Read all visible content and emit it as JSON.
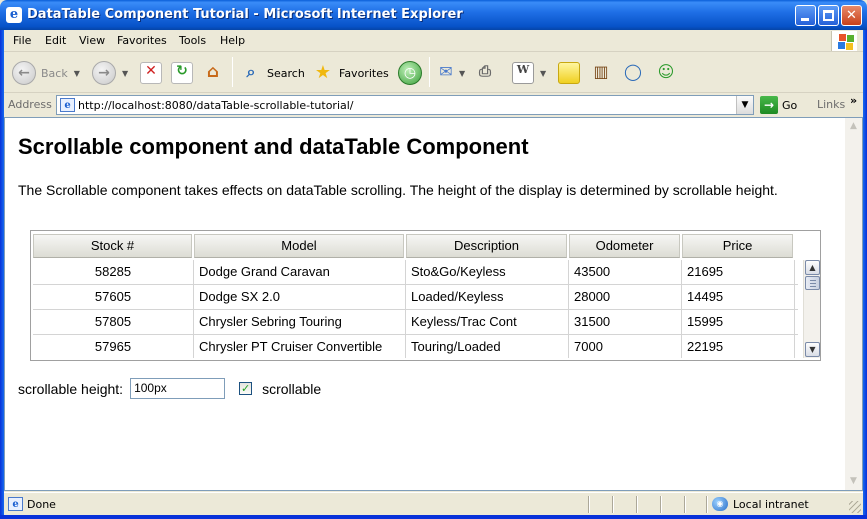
{
  "window": {
    "title": "DataTable Component Tutorial - Microsoft Internet Explorer"
  },
  "menu": [
    "File",
    "Edit",
    "View",
    "Favorites",
    "Tools",
    "Help"
  ],
  "toolbar": {
    "back_label": "Back",
    "search_label": "Search",
    "favorites_label": "Favorites"
  },
  "address": {
    "label": "Address",
    "url": "http://localhost:8080/dataTable-scrollable-tutorial/",
    "go_label": "Go",
    "links_label": "Links"
  },
  "page": {
    "heading": "Scrollable component and dataTable Component",
    "intro": "The Scrollable component takes effects on dataTable scrolling. The height of the display is determined by scrollable height."
  },
  "table": {
    "columns": [
      "Stock #",
      "Model",
      "Description",
      "Odometer",
      "Price"
    ],
    "rows": [
      [
        "58285",
        "Dodge Grand Caravan",
        "Sto&Go/Keyless",
        "43500",
        "21695"
      ],
      [
        "57605",
        "Dodge SX 2.0",
        "Loaded/Keyless",
        "28000",
        "14495"
      ],
      [
        "57805",
        "Chrysler Sebring Touring",
        "Keyless/Trac Cont",
        "31500",
        "15995"
      ],
      [
        "57965",
        "Chrysler PT Cruiser Convertible",
        "Touring/Loaded",
        "7000",
        "22195"
      ]
    ]
  },
  "controls": {
    "height_label": "scrollable height:",
    "height_value": "100px",
    "scrollable_label": "scrollable",
    "scrollable_checked": true
  },
  "status": {
    "text": "Done",
    "zone": "Local intranet"
  }
}
